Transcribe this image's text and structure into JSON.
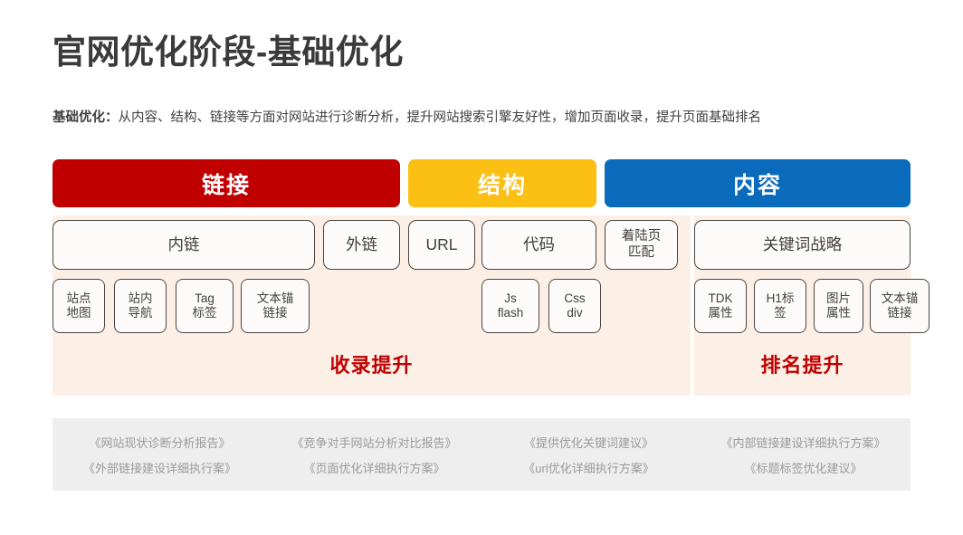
{
  "slide": {
    "title": "官网优化阶段-基础优化",
    "subtitle_lead": "基础优化：",
    "subtitle_body": "从内容、结构、链接等方面对网站进行诊断分析，提升网站搜索引擎友好性，增加页面收录，提升页面基础排名"
  },
  "colors": {
    "link_red": "#c00000",
    "structure_yellow": "#fcbf13",
    "content_blue": "#0a6bbd",
    "band_peach": "#fcf0e6",
    "footer_gray": "#eeeeee",
    "caption_red": "#c00000"
  },
  "headers": [
    {
      "label": "链接",
      "color": "#c00000"
    },
    {
      "label": "结构",
      "color": "#fcbf13"
    },
    {
      "label": "内容",
      "color": "#0a6bbd"
    }
  ],
  "row2": [
    {
      "label": "内链"
    },
    {
      "label": "外链"
    },
    {
      "label": "URL"
    },
    {
      "label": "代码"
    },
    {
      "label": "着陆页\n匹配"
    },
    {
      "label": "关键词战略"
    }
  ],
  "row3": [
    {
      "label": "站点\n地图"
    },
    {
      "label": "站内\n导航"
    },
    {
      "label": "Tag\n标签"
    },
    {
      "label": "文本锚\n链接"
    },
    {
      "label": "Js\nflash"
    },
    {
      "label": "Css\ndiv"
    },
    {
      "label": "TDK\n属性"
    },
    {
      "label": "H1标\n签"
    },
    {
      "label": "图片\n属性"
    },
    {
      "label": "文本锚\n链接"
    }
  ],
  "captions": {
    "left": "收录提升",
    "right": "排名提升"
  },
  "footer": {
    "columns": [
      {
        "items": [
          "《网站现状诊断分析报告》",
          "《外部链接建设详细执行案》"
        ]
      },
      {
        "items": [
          "《竞争对手网站分析对比报告》",
          "《页面优化详细执行方案》"
        ]
      },
      {
        "items": [
          "《提供优化关键词建议》",
          "《url优化详细执行方案》"
        ]
      },
      {
        "items": [
          "《内部链接建设详细执行方案》",
          "《标题标签优化建议》"
        ]
      }
    ]
  }
}
